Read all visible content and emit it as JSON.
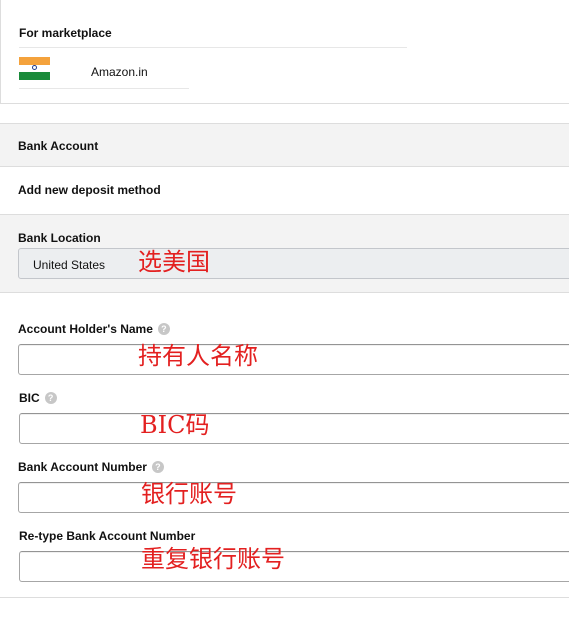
{
  "marketplace": {
    "title": "For marketplace",
    "name": "Amazon.in",
    "flag_icon": "india-flag-icon"
  },
  "bank_account": {
    "header": "Bank Account",
    "add_method": "Add new deposit method"
  },
  "bank_location": {
    "label": "Bank Location",
    "selected": "United States",
    "annotation": "选美国"
  },
  "fields": {
    "account_holder": {
      "label": "Account Holder's Name",
      "value": "",
      "annotation": "持有人名称",
      "help_icon": "question-icon"
    },
    "bic": {
      "label": "BIC",
      "value": "",
      "annotation": "BIC码",
      "help_icon": "question-icon"
    },
    "account_number": {
      "label": "Bank Account Number",
      "value": "",
      "annotation": "银行账号",
      "help_icon": "question-icon"
    },
    "retype_account_number": {
      "label": "Re-type Bank Account Number",
      "value": "",
      "annotation": "重复银行账号"
    }
  },
  "colors": {
    "annotation_red": "#e32020",
    "section_gray": "#f3f3f3",
    "border": "#dddddd"
  }
}
